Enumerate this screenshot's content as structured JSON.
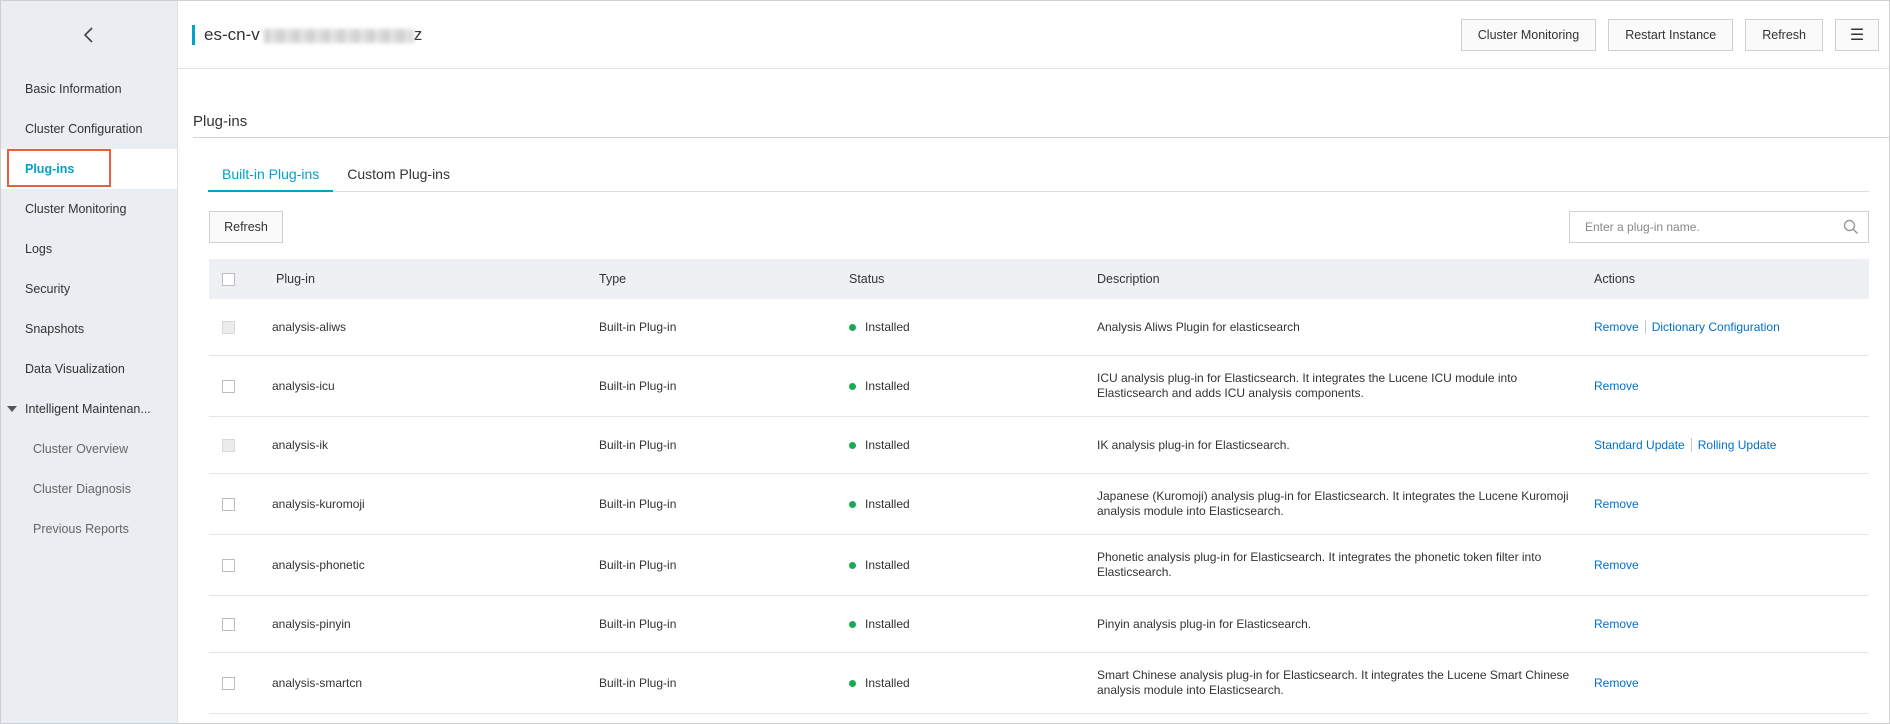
{
  "colors": {
    "accent": "#00a2ca",
    "link": "#0070cc",
    "installed": "#1aaa55",
    "highlight": "#e8613c"
  },
  "sidebar": {
    "back_icon": "chevron-left-icon",
    "items": [
      {
        "label": "Basic Information"
      },
      {
        "label": "Cluster Configuration"
      },
      {
        "label": "Plug-ins"
      },
      {
        "label": "Cluster Monitoring"
      },
      {
        "label": "Logs"
      },
      {
        "label": "Security"
      },
      {
        "label": "Snapshots"
      },
      {
        "label": "Data Visualization"
      },
      {
        "label": "Intelligent Maintenan..."
      },
      {
        "label": "Cluster Overview"
      },
      {
        "label": "Cluster Diagnosis"
      },
      {
        "label": "Previous Reports"
      }
    ]
  },
  "header": {
    "title": "es-cn-v",
    "title_tail": "z",
    "buttons": {
      "monitoring": "Cluster Monitoring",
      "restart": "Restart Instance",
      "refresh": "Refresh",
      "menu": "☰"
    }
  },
  "main": {
    "section_title": "Plug-ins",
    "tabs": [
      {
        "label": "Built-in Plug-ins"
      },
      {
        "label": "Custom Plug-ins"
      }
    ],
    "refresh_label": "Refresh",
    "search": {
      "placeholder": "Enter a plug-in name.",
      "icon": "search-icon"
    },
    "table": {
      "headers": {
        "name": "Plug-in",
        "type": "Type",
        "status": "Status",
        "description": "Description",
        "actions": "Actions"
      },
      "rows": [
        {
          "name": "analysis-aliws",
          "type": "Built-in Plug-in",
          "status": "Installed",
          "description": "Analysis Aliws Plugin for elasticsearch",
          "actions": [
            "Remove",
            "Dictionary Configuration"
          ]
        },
        {
          "name": "analysis-icu",
          "type": "Built-in Plug-in",
          "status": "Installed",
          "description": "ICU analysis plug-in for Elasticsearch. It integrates the Lucene ICU module into Elasticsearch and adds ICU analysis components.",
          "actions": [
            "Remove"
          ]
        },
        {
          "name": "analysis-ik",
          "type": "Built-in Plug-in",
          "status": "Installed",
          "description": "IK analysis plug-in for Elasticsearch.",
          "actions": [
            "Standard Update",
            "Rolling Update"
          ]
        },
        {
          "name": "analysis-kuromoji",
          "type": "Built-in Plug-in",
          "status": "Installed",
          "description": "Japanese (Kuromoji) analysis plug-in for Elasticsearch. It integrates the Lucene Kuromoji analysis module into Elasticsearch.",
          "actions": [
            "Remove"
          ]
        },
        {
          "name": "analysis-phonetic",
          "type": "Built-in Plug-in",
          "status": "Installed",
          "description": "Phonetic analysis plug-in for Elasticsearch. It integrates the phonetic token filter into Elasticsearch.",
          "actions": [
            "Remove"
          ]
        },
        {
          "name": "analysis-pinyin",
          "type": "Built-in Plug-in",
          "status": "Installed",
          "description": "Pinyin analysis plug-in for Elasticsearch.",
          "actions": [
            "Remove"
          ]
        },
        {
          "name": "analysis-smartcn",
          "type": "Built-in Plug-in",
          "status": "Installed",
          "description": "Smart Chinese analysis plug-in for Elasticsearch. It integrates the Lucene Smart Chinese analysis module into Elasticsearch.",
          "actions": [
            "Remove"
          ]
        }
      ]
    }
  }
}
